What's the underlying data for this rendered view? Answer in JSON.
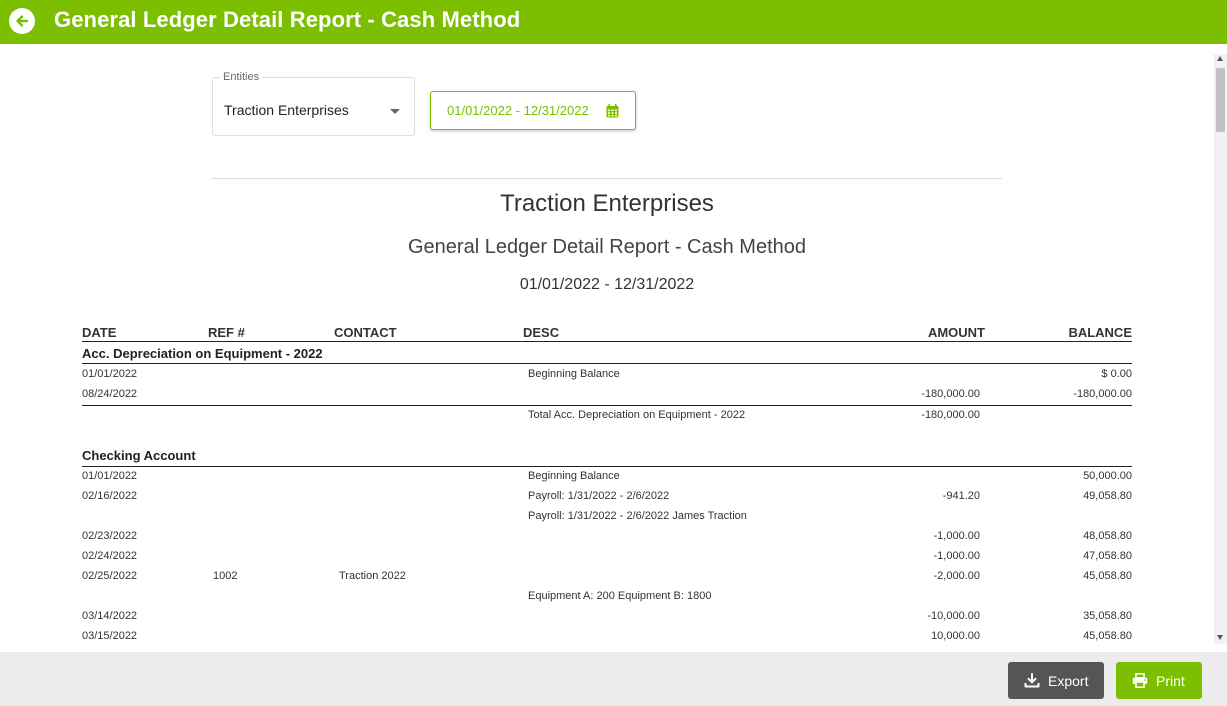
{
  "header": {
    "title": "General Ledger Detail Report - Cash Method"
  },
  "filters": {
    "entities_label": "Entities",
    "entities_value": "Traction Enterprises",
    "date_range": "01/01/2022 - 12/31/2022"
  },
  "report": {
    "entity": "Traction Enterprises",
    "title": "General Ledger Detail Report - Cash Method",
    "range": "01/01/2022 - 12/31/2022",
    "columns": {
      "date": "DATE",
      "ref": "REF #",
      "contact": "CONTACT",
      "desc": "DESC",
      "amount": "AMOUNT",
      "balance": "BALANCE"
    },
    "sections": [
      {
        "title": "Acc. Depreciation on Equipment - 2022",
        "rows": [
          {
            "date": "01/01/2022",
            "ref": "",
            "contact": "",
            "desc": "Beginning Balance",
            "amount": "",
            "balance": "$ 0.00"
          },
          {
            "date": "08/24/2022",
            "ref": "",
            "contact": "",
            "desc": "",
            "amount": "-180,000.00",
            "balance": "-180,000.00"
          }
        ],
        "total": {
          "desc": "Total Acc. Depreciation on Equipment - 2022",
          "amount": "-180,000.00"
        }
      },
      {
        "title": "Checking Account",
        "rows": [
          {
            "date": "01/01/2022",
            "ref": "",
            "contact": "",
            "desc": "Beginning Balance",
            "amount": "",
            "balance": "50,000.00"
          },
          {
            "date": "02/16/2022",
            "ref": "",
            "contact": "",
            "desc": "Payroll: 1/31/2022 - 2/6/2022",
            "amount": "-941.20",
            "balance": "49,058.80"
          },
          {
            "date": "",
            "ref": "",
            "contact": "",
            "desc": "Payroll: 1/31/2022 - 2/6/2022 James Traction",
            "amount": "",
            "balance": ""
          },
          {
            "date": "02/23/2022",
            "ref": "",
            "contact": "",
            "desc": "",
            "amount": "-1,000.00",
            "balance": "48,058.80"
          },
          {
            "date": "02/24/2022",
            "ref": "",
            "contact": "",
            "desc": "",
            "amount": "-1,000.00",
            "balance": "47,058.80"
          },
          {
            "date": "02/25/2022",
            "ref": "1002",
            "contact": "Traction 2022",
            "desc": "",
            "amount": "-2,000.00",
            "balance": "45,058.80"
          },
          {
            "date": "",
            "ref": "",
            "contact": "",
            "desc": "Equipment A: 200 Equipment B: 1800",
            "amount": "",
            "balance": ""
          },
          {
            "date": "03/14/2022",
            "ref": "",
            "contact": "",
            "desc": "",
            "amount": "-10,000.00",
            "balance": "35,058.80"
          },
          {
            "date": "03/15/2022",
            "ref": "",
            "contact": "",
            "desc": "",
            "amount": "10,000.00",
            "balance": "45,058.80"
          }
        ]
      }
    ]
  },
  "footer": {
    "export_label": "Export",
    "print_label": "Print"
  },
  "colors": {
    "brand": "#7cbf00",
    "export_bg": "#555555"
  }
}
